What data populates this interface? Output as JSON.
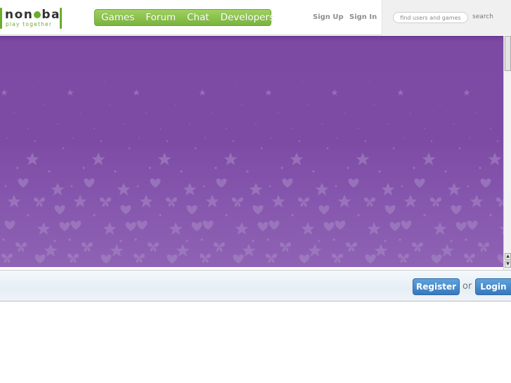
{
  "header": {
    "logo": {
      "word_left": "non",
      "word_right": "ba",
      "tagline": "play together"
    },
    "nav": [
      "Games",
      "Forum",
      "Chat",
      "Developers"
    ],
    "sign_up": "Sign Up",
    "sign_in": "Sign In",
    "search": {
      "placeholder": "find users and games",
      "button": "search"
    }
  },
  "footer_bar": {
    "register": "Register",
    "or": "or",
    "login": "Login"
  },
  "colors": {
    "brand_green": "#6aac2c",
    "stage_purple": "#7e4ba4",
    "button_blue": "#3f84c8"
  },
  "icons": {
    "scroll_up": "scroll-up-arrow-icon",
    "scroll_down": "scroll-down-arrow-icon"
  }
}
